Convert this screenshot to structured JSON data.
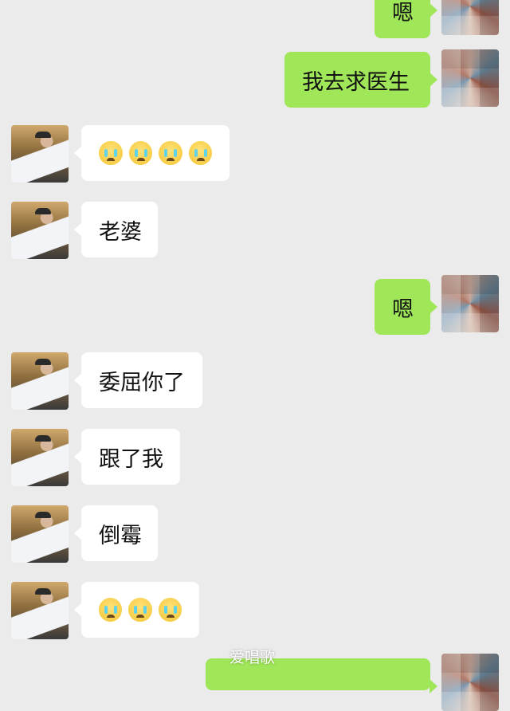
{
  "messages": [
    {
      "side": "self",
      "text": "嗯"
    },
    {
      "side": "self",
      "text": "我去求医生"
    },
    {
      "side": "other",
      "emoji_count": 4,
      "emoji": "crying-face-icon"
    },
    {
      "side": "other",
      "text": "老婆"
    },
    {
      "side": "self",
      "text": "嗯"
    },
    {
      "side": "other",
      "text": "委屈你了"
    },
    {
      "side": "other",
      "text": "跟了我"
    },
    {
      "side": "other",
      "text": "倒霉"
    },
    {
      "side": "other",
      "emoji_count": 3,
      "emoji": "crying-face-icon"
    }
  ],
  "watermark": "爱唱歌",
  "colors": {
    "background": "#ebebeb",
    "self_bubble": "#9fe658",
    "other_bubble": "#ffffff"
  }
}
